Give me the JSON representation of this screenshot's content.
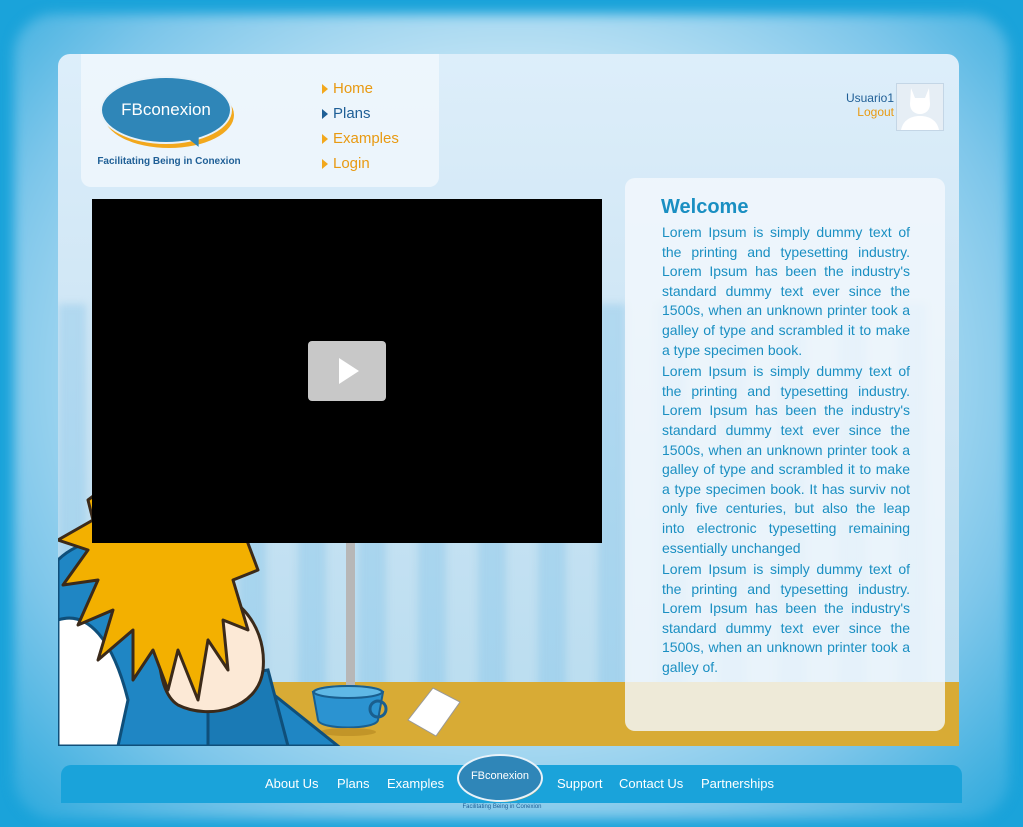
{
  "brand": {
    "logo_text": "FBconexion",
    "tagline": "Facilitating Being in Conexion"
  },
  "nav": {
    "items": [
      {
        "label": "Home"
      },
      {
        "label": "Plans"
      },
      {
        "label": "Examples"
      },
      {
        "label": "Login"
      }
    ]
  },
  "user": {
    "name": "Usuario1",
    "logout_label": "Logout",
    "avatar_icon": "user-silhouette-icon"
  },
  "video": {
    "play_icon": "play-icon"
  },
  "welcome": {
    "title": "Welcome",
    "paragraphs": [
      "Lorem Ipsum is simply dummy text of the printing and typesetting industry. Lorem Ipsum has been the industry's standard dummy text ever since the 1500s, when an unknown printer took a galley of type and scrambled it to make a type specimen book.",
      "Lorem Ipsum is simply dummy text of the printing and typesetting industry. Lorem Ipsum has been the industry's standard dummy text ever since the 1500s, when an unknown printer took a galley of type and scrambled it to make a type specimen book. It has surviv not only five centuries, but also the leap into electronic typesetting remaining essentially unchanged",
      "Lorem Ipsum is simply dummy text of the printing and typesetting industry. Lorem Ipsum has been the industry's standard dummy text ever since the 1500s, when an unknown printer took a galley of."
    ]
  },
  "footer": {
    "links": [
      {
        "label": "About Us"
      },
      {
        "label": "Plans"
      },
      {
        "label": "Examples"
      },
      {
        "label": "Support"
      },
      {
        "label": "Contact Us"
      },
      {
        "label": "Partnerships"
      }
    ],
    "logo_text": "FBconexion",
    "logo_tagline": "Facilitating Being in Conexion"
  },
  "colors": {
    "accent_orange": "#f2a81d",
    "brand_blue": "#2f86b8",
    "text_blue": "#1a8fc2",
    "footer_blue": "#1aa3da"
  }
}
